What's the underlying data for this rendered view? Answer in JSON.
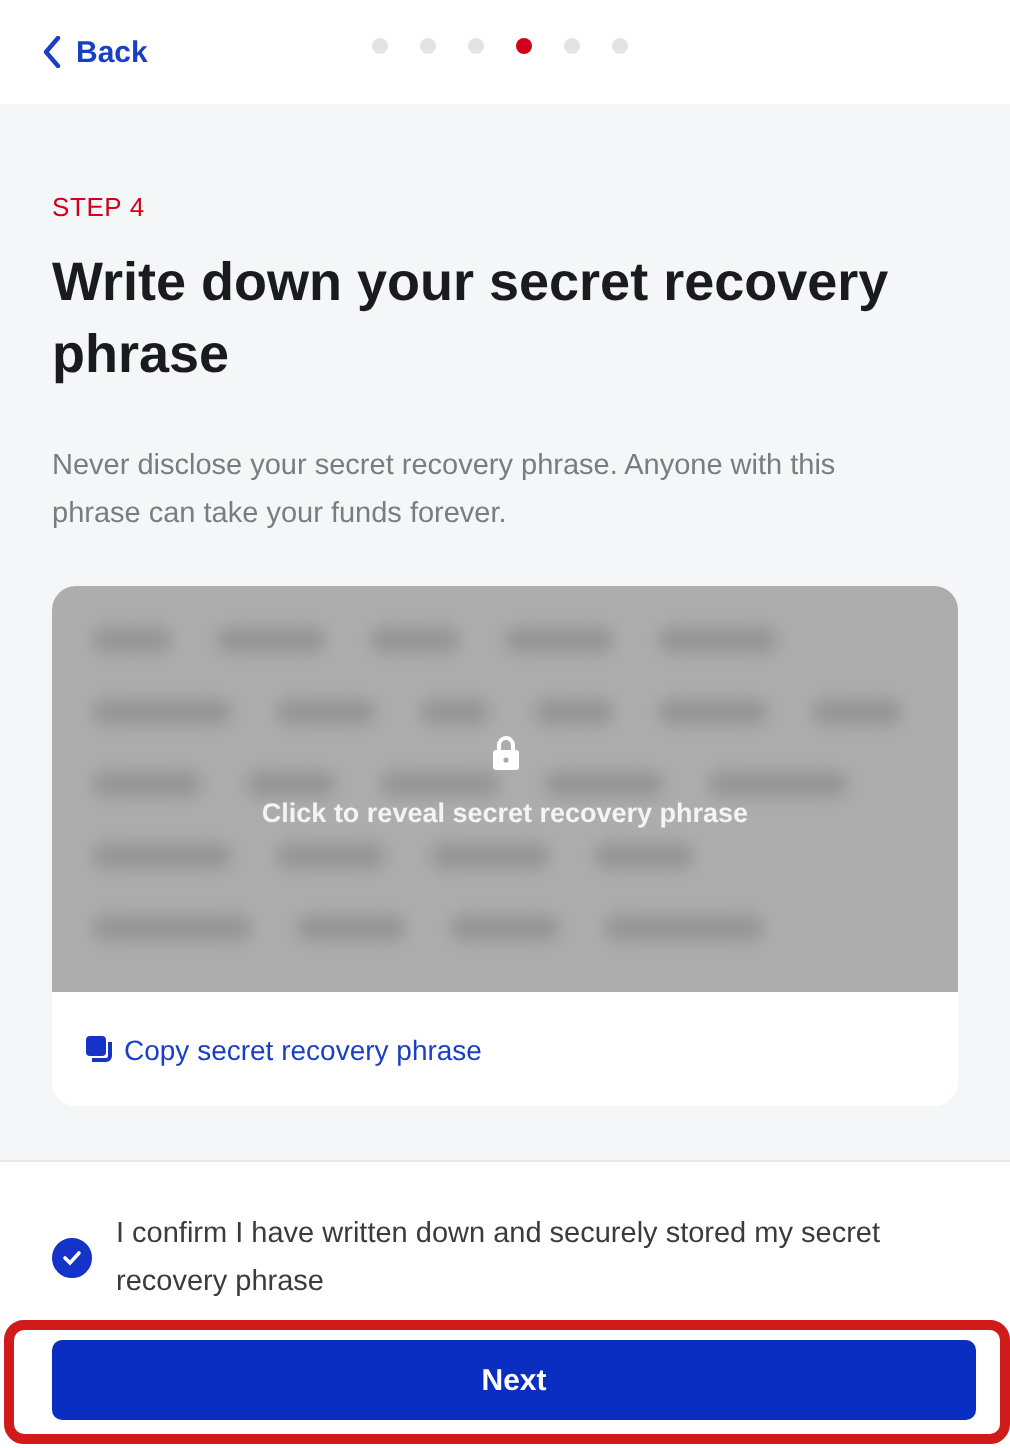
{
  "header": {
    "back": "Back",
    "steps": [
      {
        "selected": false
      },
      {
        "selected": false
      },
      {
        "selected": false
      },
      {
        "selected": true
      },
      {
        "selected": false
      },
      {
        "selected": false
      }
    ]
  },
  "step_label": "STEP 4",
  "title": "Write down your secret recovery phrase",
  "description": "Never disclose your secret recovery phrase. Anyone with this phrase can take your funds forever.",
  "phrase_card": {
    "reveal_label": "Click to reveal secret recovery phrase",
    "copy_label": "Copy secret recovery phrase"
  },
  "confirm": {
    "label": "I confirm I have written down and securely stored my secret recovery phrase",
    "checked": true
  },
  "next_button": "Next"
}
